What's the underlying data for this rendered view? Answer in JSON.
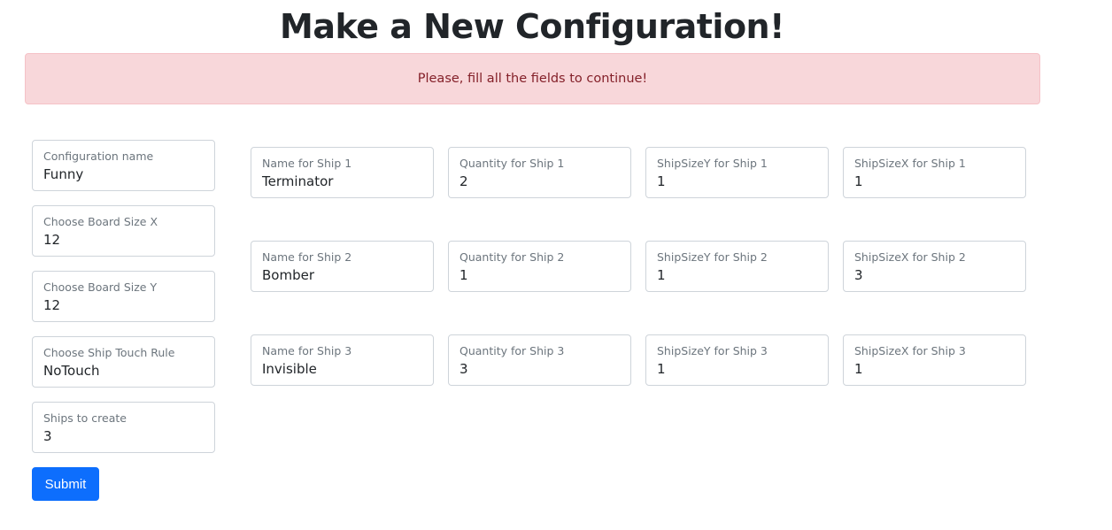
{
  "page": {
    "title": "Make a New Configuration!"
  },
  "alert": {
    "message": "Please, fill all the fields to continue!"
  },
  "config_fields": [
    {
      "label": "Configuration name",
      "value": "Funny"
    },
    {
      "label": "Choose Board Size X",
      "value": "12"
    },
    {
      "label": "Choose Board Size Y",
      "value": "12"
    },
    {
      "label": "Choose Ship Touch Rule",
      "value": "NoTouch"
    },
    {
      "label": "Ships to create",
      "value": "3"
    }
  ],
  "ships": [
    {
      "name": {
        "label": "Name for Ship 1",
        "value": "Terminator"
      },
      "quantity": {
        "label": "Quantity for Ship 1",
        "value": "2"
      },
      "size_y": {
        "label": "ShipSizeY for Ship 1",
        "value": "1"
      },
      "size_x": {
        "label": "ShipSizeX for Ship 1",
        "value": "1"
      }
    },
    {
      "name": {
        "label": "Name for Ship 2",
        "value": "Bomber"
      },
      "quantity": {
        "label": "Quantity for Ship 2",
        "value": "1"
      },
      "size_y": {
        "label": "ShipSizeY for Ship 2",
        "value": "1"
      },
      "size_x": {
        "label": "ShipSizeX for Ship 2",
        "value": "3"
      }
    },
    {
      "name": {
        "label": "Name for Ship 3",
        "value": "Invisible"
      },
      "quantity": {
        "label": "Quantity for Ship 3",
        "value": "3"
      },
      "size_y": {
        "label": "ShipSizeY for Ship 3",
        "value": "1"
      },
      "size_x": {
        "label": "ShipSizeX for Ship 3",
        "value": "1"
      }
    }
  ],
  "submit": {
    "label": "Submit"
  },
  "colors": {
    "alert_bg": "#f8d7da",
    "alert_text": "#842029",
    "primary": "#0d6efd"
  }
}
